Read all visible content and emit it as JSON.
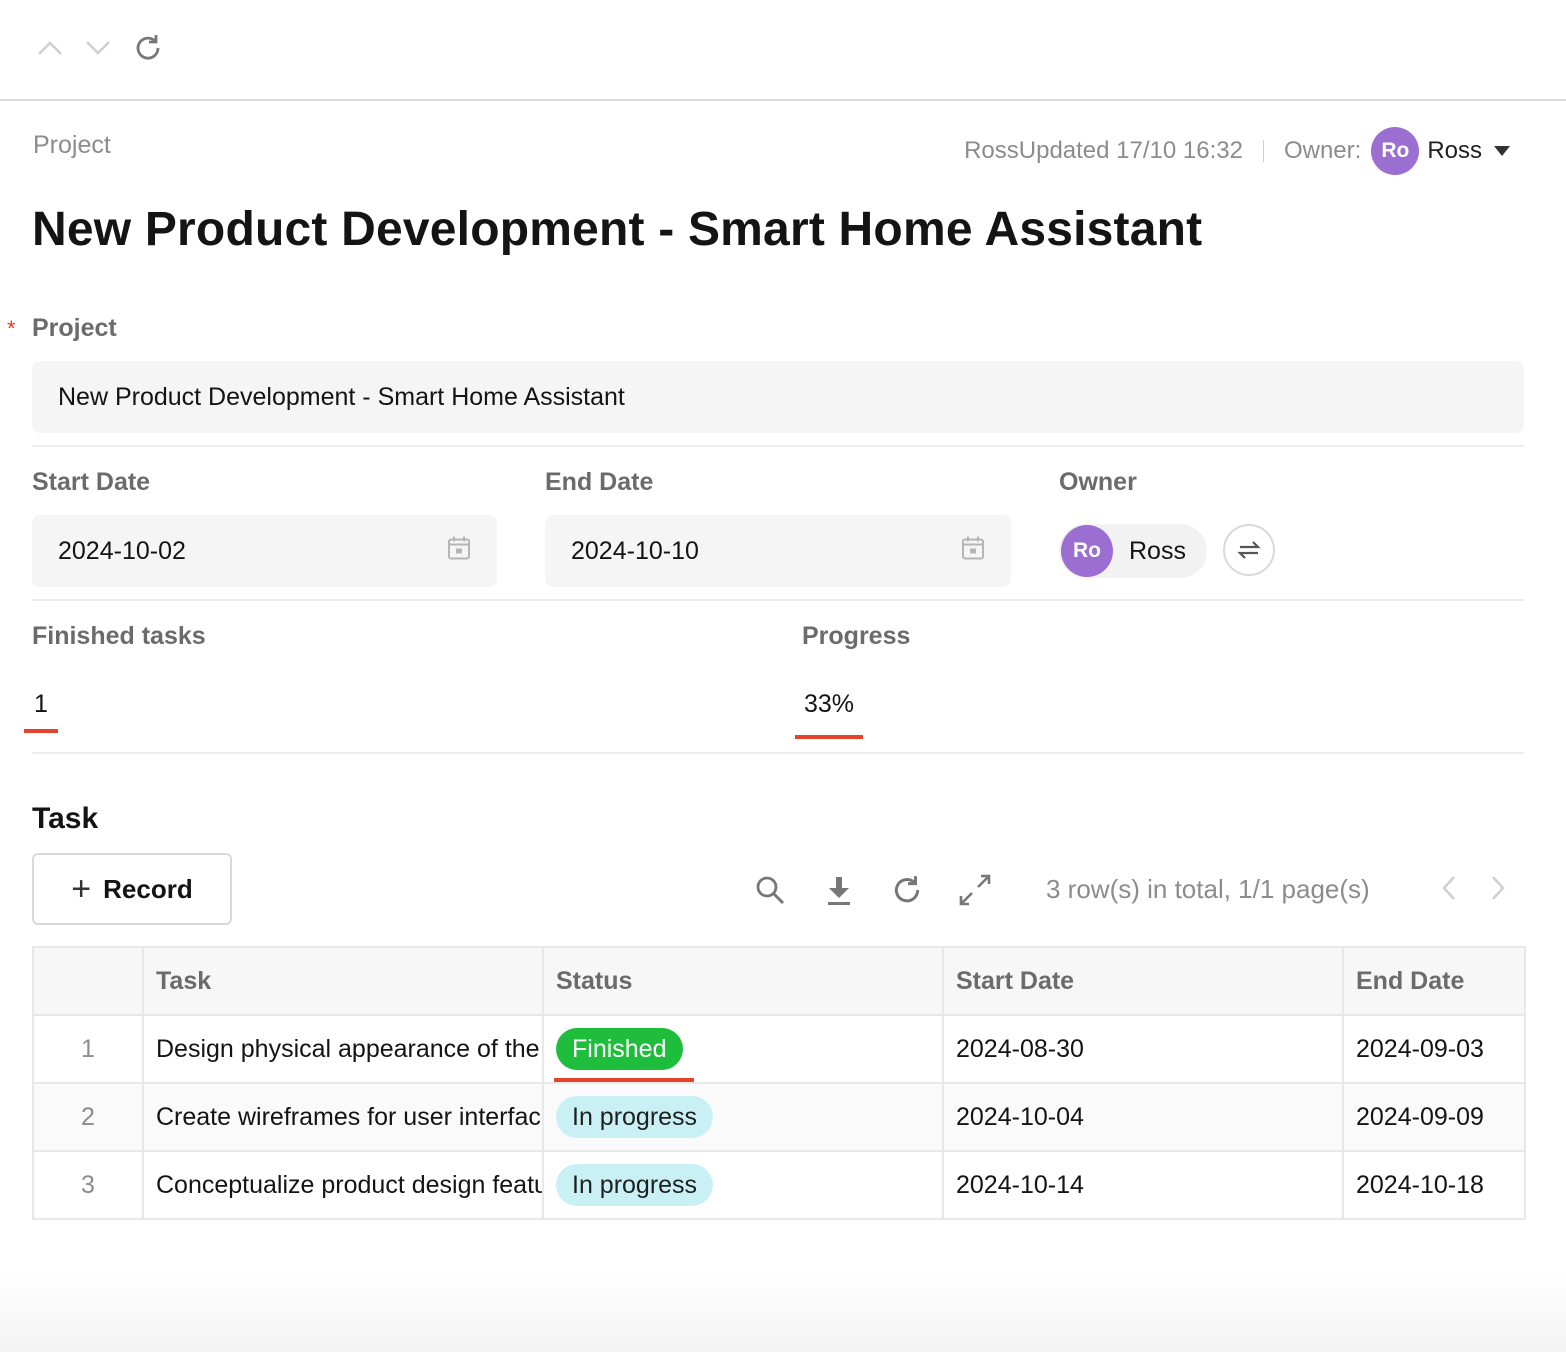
{
  "breadcrumb": "Project",
  "meta": {
    "updated": "RossUpdated 17/10 16:32",
    "owner_label": "Owner:",
    "owner_initials": "Ro",
    "owner_name": "Ross"
  },
  "title": "New Product Development - Smart Home Assistant",
  "form": {
    "project_label": "Project",
    "project_value": "New Product Development - Smart Home Assistant",
    "start_label": "Start Date",
    "start_value": "2024-10-02",
    "end_label": "End Date",
    "end_value": "2024-10-10",
    "owner_label": "Owner",
    "owner_initials": "Ro",
    "owner_name": "Ross",
    "finished_label": "Finished tasks",
    "finished_value": "1",
    "progress_label": "Progress",
    "progress_value": "33%"
  },
  "task": {
    "section_title": "Task",
    "record_label": "Record",
    "pager": "3 row(s) in total, 1/1 page(s)",
    "columns": [
      "",
      "Task",
      "Status",
      "Start Date",
      "End Date"
    ],
    "rows": [
      {
        "idx": "1",
        "task": "Design physical appearance of the product",
        "status": "Finished",
        "start": "2024-08-30",
        "end": "2024-09-03"
      },
      {
        "idx": "2",
        "task": "Create wireframes for user interface",
        "status": "In progress",
        "start": "2024-10-04",
        "end": "2024-09-09"
      },
      {
        "idx": "3",
        "task": "Conceptualize product design features",
        "status": "In progress",
        "start": "2024-10-14",
        "end": "2024-10-18"
      }
    ]
  },
  "colors": {
    "accent_red": "#e5432b",
    "avatar": "#9b6fd1",
    "finished_tag": "#1fbd3c",
    "progress_tag": "#c9f1f5"
  },
  "icons": [
    "chevron-up-icon",
    "chevron-down-icon",
    "refresh-icon",
    "calendar-icon",
    "swap-icon",
    "plus-icon",
    "search-icon",
    "download-icon",
    "expand-icon",
    "chevron-left-icon",
    "chevron-right-icon"
  ]
}
